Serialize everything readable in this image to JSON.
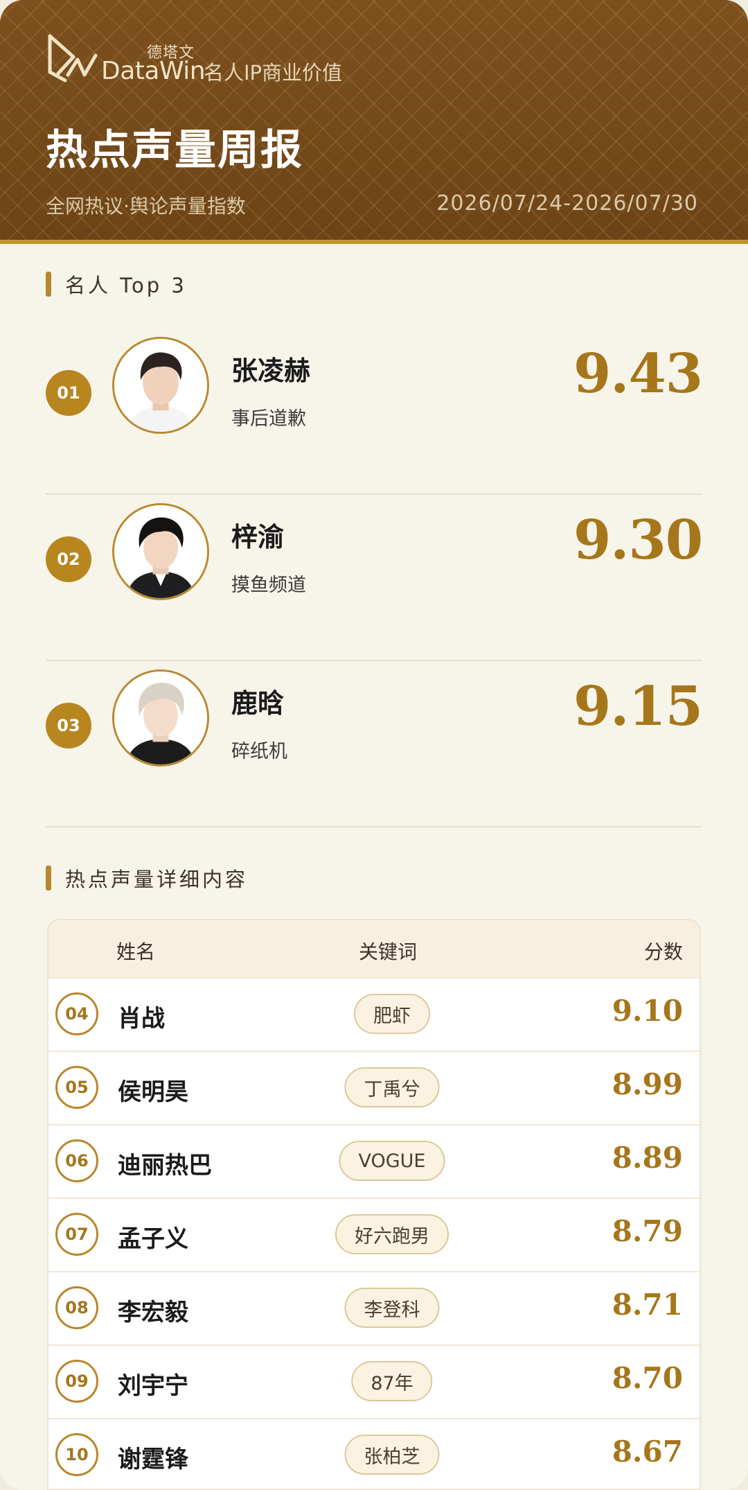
{
  "header": {
    "brand_cn": "德塔文",
    "brand_en": "DataWin",
    "tagline": "名人IP商业价值",
    "title": "热点声量周报",
    "subtitle": "全网热议·舆论声量指数",
    "date_range": "2026/07/24-2026/07/30",
    "colors": {
      "header_bg": "#7b4f1d",
      "accent": "#b8862b",
      "score": "#a6761b"
    }
  },
  "top3": {
    "heading": "名人 Top 3",
    "items": [
      {
        "rank": "01",
        "name": "张凌赫",
        "tag": "事后道歉",
        "score": "9.43"
      },
      {
        "rank": "02",
        "name": "梓渝",
        "tag": "摸鱼频道",
        "score": "9.30"
      },
      {
        "rank": "03",
        "name": "鹿晗",
        "tag": "碎纸机",
        "score": "9.15"
      }
    ]
  },
  "details": {
    "heading": "热点声量详细内容",
    "columns": {
      "name": "姓名",
      "keyword": "关键词",
      "score": "分数"
    },
    "rows": [
      {
        "rank": "04",
        "name": "肖战",
        "keyword": "肥虾",
        "score": "9.10"
      },
      {
        "rank": "05",
        "name": "侯明昊",
        "keyword": "丁禹兮",
        "score": "8.99"
      },
      {
        "rank": "06",
        "name": "迪丽热巴",
        "keyword": "VOGUE",
        "score": "8.89"
      },
      {
        "rank": "07",
        "name": "孟子义",
        "keyword": "好六跑男",
        "score": "8.79"
      },
      {
        "rank": "08",
        "name": "李宏毅",
        "keyword": "李登科",
        "score": "8.71"
      },
      {
        "rank": "09",
        "name": "刘宇宁",
        "keyword": "87年",
        "score": "8.70"
      },
      {
        "rank": "10",
        "name": "谢霆锋",
        "keyword": "张柏芝",
        "score": "8.67"
      }
    ]
  }
}
